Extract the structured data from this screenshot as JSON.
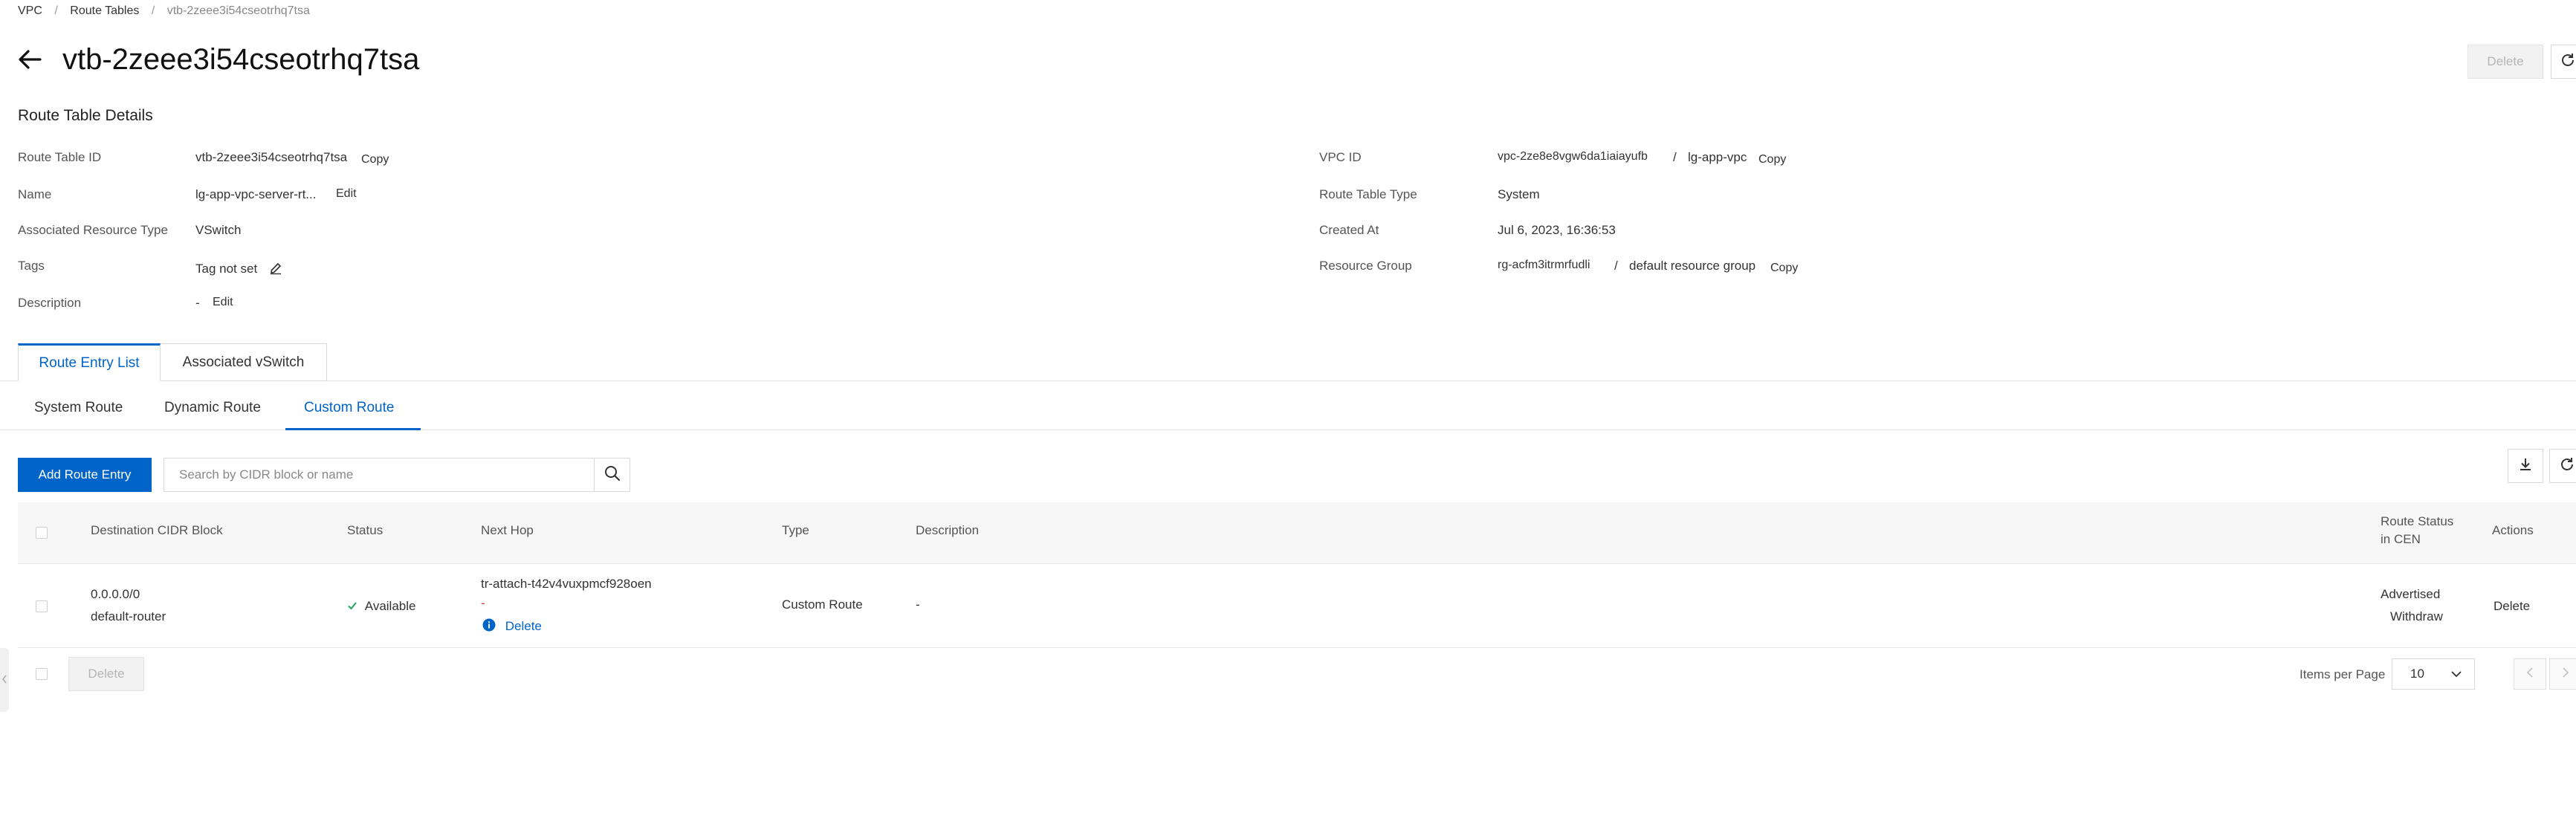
{
  "breadcrumb": {
    "items": [
      "VPC",
      "Route Tables"
    ],
    "separator": "/",
    "current": "vtb-2zeee3i54cseotrhq7tsa"
  },
  "header": {
    "title": "vtb-2zeee3i54cseotrhq7tsa",
    "delete_label": "Delete"
  },
  "details": {
    "section_title": "Route Table Details",
    "left": {
      "route_table_id_label": "Route Table ID",
      "route_table_id_value": "vtb-2zeee3i54cseotrhq7tsa",
      "copy_label": "Copy",
      "name_label": "Name",
      "name_value": "lg-app-vpc-server-rt...",
      "edit_label": "Edit",
      "assoc_type_label": "Associated Resource Type",
      "assoc_type_value": "VSwitch",
      "tags_label": "Tags",
      "tags_value": "Tag not set",
      "description_label": "Description",
      "description_value": "-",
      "description_edit": "Edit"
    },
    "right": {
      "vpc_id_label": "VPC ID",
      "vpc_id_link": "vpc-2ze8e8vgw6da1iaiayufb",
      "vpc_sep": "/",
      "vpc_name": "lg-app-vpc",
      "copy_label": "Copy",
      "type_label": "Route Table Type",
      "type_value": "System",
      "created_label": "Created At",
      "created_value": "Jul 6, 2023, 16:36:53",
      "rg_label": "Resource Group",
      "rg_link": "rg-acfm3itrmrfudli",
      "rg_sep": "/",
      "rg_name": "default resource group",
      "rg_copy": "Copy"
    }
  },
  "tabs": [
    "Route Entry List",
    "Associated vSwitch"
  ],
  "subtabs": [
    "System Route",
    "Dynamic Route",
    "Custom Route"
  ],
  "toolbar": {
    "add_label": "Add Route Entry",
    "search_placeholder": "Search by CIDR block or name"
  },
  "table": {
    "headers": {
      "destination": "Destination CIDR Block",
      "status": "Status",
      "next_hop": "Next Hop",
      "type": "Type",
      "description": "Description",
      "cen_line1": "Route Status",
      "cen_line2": "in CEN",
      "actions": "Actions"
    },
    "rows": [
      {
        "destination": "0.0.0.0/0",
        "name": "default-router",
        "status": "Available",
        "next_hop": "tr-attach-t42v4vuxpmcf928oen",
        "next_hop_dash": "-",
        "next_hop_delete": "Delete",
        "type": "Custom Route",
        "description": "-",
        "cen_status": "Advertised",
        "cen_action": "Withdraw",
        "action": "Delete"
      }
    ]
  },
  "footer": {
    "delete_label": "Delete",
    "items_per_page_label": "Items per Page",
    "page_size": "10"
  },
  "colors": {
    "primary": "#0064c8",
    "status_ok": "#23a25d",
    "info": "#0064c8"
  },
  "icons": [
    "back-arrow-icon",
    "refresh-icon",
    "edit-pencil-icon",
    "search-icon",
    "download-icon",
    "checkmark-icon",
    "info-icon",
    "chevron-down-icon",
    "chevron-left-icon",
    "chevron-right-icon"
  ]
}
